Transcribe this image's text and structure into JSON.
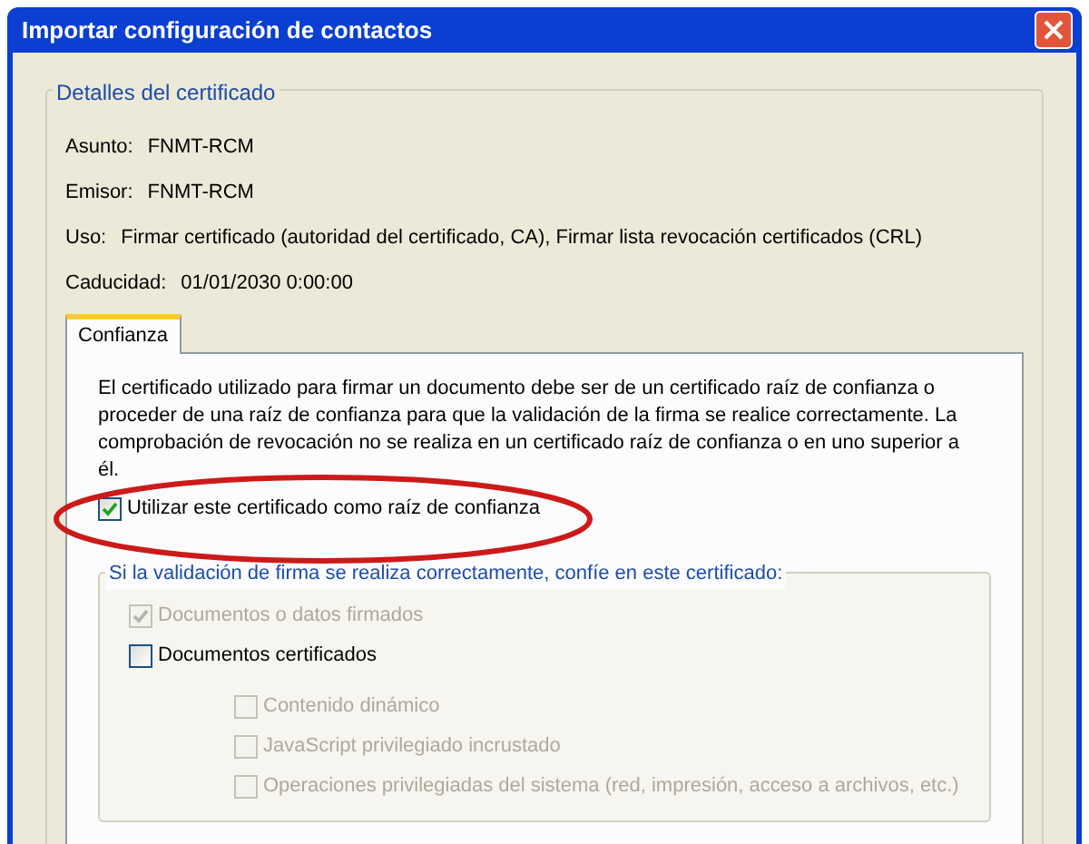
{
  "window": {
    "title": "Importar configuración de contactos"
  },
  "details": {
    "legend": "Detalles del certificado",
    "fields": [
      {
        "label": "Asunto:",
        "value": "FNMT-RCM"
      },
      {
        "label": "Emisor:",
        "value": "FNMT-RCM"
      },
      {
        "label": "Uso:",
        "value": "Firmar certificado (autoridad del certificado, CA), Firmar lista revocación certificados (CRL)"
      },
      {
        "label": "Caducidad:",
        "value": "01/01/2030 0:00:00"
      }
    ]
  },
  "tabs": [
    {
      "label": "Confianza",
      "selected": true
    }
  ],
  "trust": {
    "description": "El certificado utilizado para firmar un documento debe ser de un certificado raíz de confianza o proceder de una raíz de confianza para que la validación de la firma se realice correctamente. La comprobación de revocación no se realiza en un certificado raíz de confianza o en uno superior a él.",
    "root_checkbox": {
      "label": "Utilizar este certificado como raíz de confianza",
      "checked": true,
      "disabled": false
    },
    "group_legend": "Si la validación de firma se realiza correctamente, confíe en este certificado:",
    "options": [
      {
        "label": "Documentos o datos firmados",
        "checked": true,
        "disabled": true
      },
      {
        "label": "Documentos certificados",
        "checked": false,
        "disabled": false,
        "children": [
          {
            "label": "Contenido dinámico",
            "checked": false,
            "disabled": true
          },
          {
            "label": "JavaScript privilegiado incrustado",
            "checked": false,
            "disabled": true
          },
          {
            "label": "Operaciones privilegiadas del sistema (red, impresión, acceso a archivos, etc.)",
            "checked": false,
            "disabled": true
          }
        ]
      }
    ]
  },
  "annotation": {
    "kind": "ellipse",
    "color": "#cc1a1a"
  }
}
